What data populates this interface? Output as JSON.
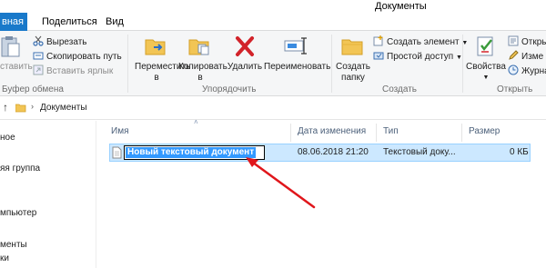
{
  "window": {
    "title": "Документы"
  },
  "menu": {
    "tabs": [
      {
        "label": "вная"
      },
      {
        "label": "Поделиться"
      },
      {
        "label": "Вид"
      }
    ]
  },
  "ribbon": {
    "clipboard": {
      "paste_label": "ставить",
      "cut_label": "Вырезать",
      "copy_path_label": "Скопировать путь",
      "paste_shortcut_label": "Вставить ярлык",
      "group_label": "Буфер обмена"
    },
    "organize": {
      "move_label": "Переместить",
      "move_sub": "в",
      "copy_label": "Копировать",
      "copy_sub": "в",
      "delete_label": "Удалить",
      "rename_label": "Переименовать",
      "group_label": "Упорядочить"
    },
    "create": {
      "new_folder_label": "Создать",
      "new_folder_sub": "папку",
      "new_item_label": "Создать элемент",
      "easy_access_label": "Простой доступ",
      "group_label": "Создать"
    },
    "open": {
      "properties_label": "Свойства",
      "open_label": "Откры",
      "edit_label": "Изме",
      "history_label": "Журна",
      "group_label": "Открыть"
    }
  },
  "address": {
    "path": "Документы"
  },
  "nav": {
    "items": [
      {
        "label": "ное"
      },
      {
        "label": "яя группа"
      },
      {
        "label": "мпьютер"
      },
      {
        "label": "менты"
      },
      {
        "label": "ки"
      }
    ]
  },
  "columns": {
    "name": "Имя",
    "date": "Дата изменения",
    "type": "Тип",
    "size": "Размер"
  },
  "files": [
    {
      "name": "Новый текстовый документ",
      "date": "08.06.2018 21:20",
      "type": "Текстовый доку...",
      "size": "0 КБ"
    }
  ],
  "colors": {
    "accent": "#1979ca",
    "selection": "#cce8ff",
    "rename_highlight": "#3399ff",
    "arrow": "#e0161b"
  },
  "icons": {
    "paste": "clipboard-icon",
    "cut": "scissors-icon",
    "copy_path": "copy-path-icon",
    "paste_shortcut": "shortcut-icon",
    "move": "move-folder-icon",
    "copy": "copy-folder-icon",
    "delete": "delete-x-icon",
    "rename": "rename-icon",
    "new_folder": "new-folder-icon",
    "new_item": "new-item-icon",
    "easy_access": "easy-access-icon",
    "properties": "properties-icon",
    "file": "text-file-icon"
  }
}
